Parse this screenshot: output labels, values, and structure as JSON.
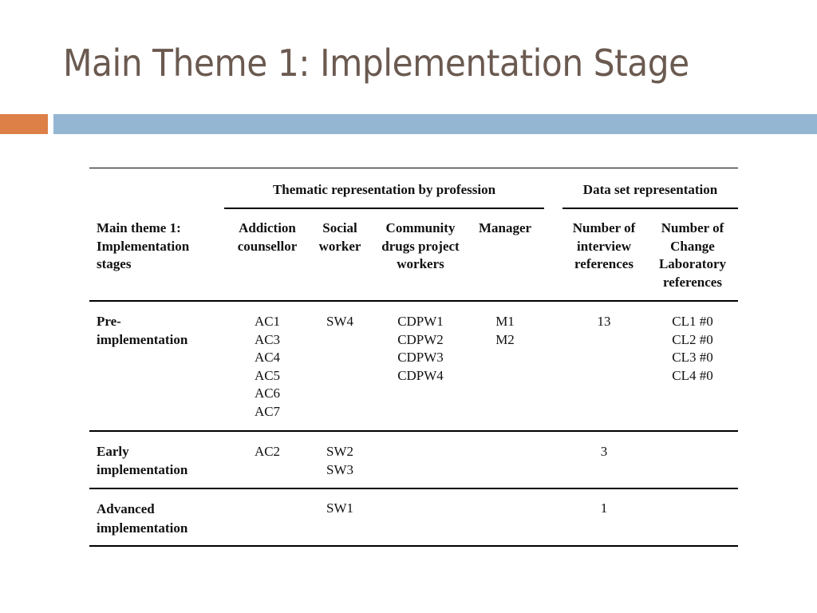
{
  "slide": {
    "title": "Main Theme 1: Implementation Stage",
    "accent_colors": {
      "title_text": "#6b5a50",
      "orange_bar": "#dd8047",
      "blue_bar": "#94b6d2"
    }
  },
  "table": {
    "group_headers": {
      "thematic": "Thematic representation by profession",
      "dataset": "Data set representation"
    },
    "columns": {
      "stage": "Main theme 1:\nImplementation\nstages",
      "addiction_counsellor": "Addiction\ncounsellor",
      "social_worker": "Social\nworker",
      "cdpw": "Community\ndrugs project\nworkers",
      "manager": "Manager",
      "interview_refs": "Number of\ninterview\nreferences",
      "cl_refs": "Number of\nChange\nLaboratory\nreferences"
    },
    "rows": [
      {
        "stage": "Pre-\nimplementation",
        "addiction_counsellor": "AC1\nAC3\nAC4\nAC5\nAC6\nAC7",
        "social_worker": "SW4",
        "cdpw": "CDPW1\nCDPW2\nCDPW3\nCDPW4",
        "manager": "M1\nM2",
        "interview_refs": "13",
        "cl_refs": "CL1 #0\nCL2 #0\nCL3 #0\nCL4 #0"
      },
      {
        "stage": "Early\nimplementation",
        "addiction_counsellor": "AC2",
        "social_worker": "SW2\nSW3",
        "cdpw": "",
        "manager": "",
        "interview_refs": "3",
        "cl_refs": ""
      },
      {
        "stage": "Advanced\nimplementation",
        "addiction_counsellor": "",
        "social_worker": "SW1",
        "cdpw": "",
        "manager": "",
        "interview_refs": "1",
        "cl_refs": ""
      }
    ]
  }
}
